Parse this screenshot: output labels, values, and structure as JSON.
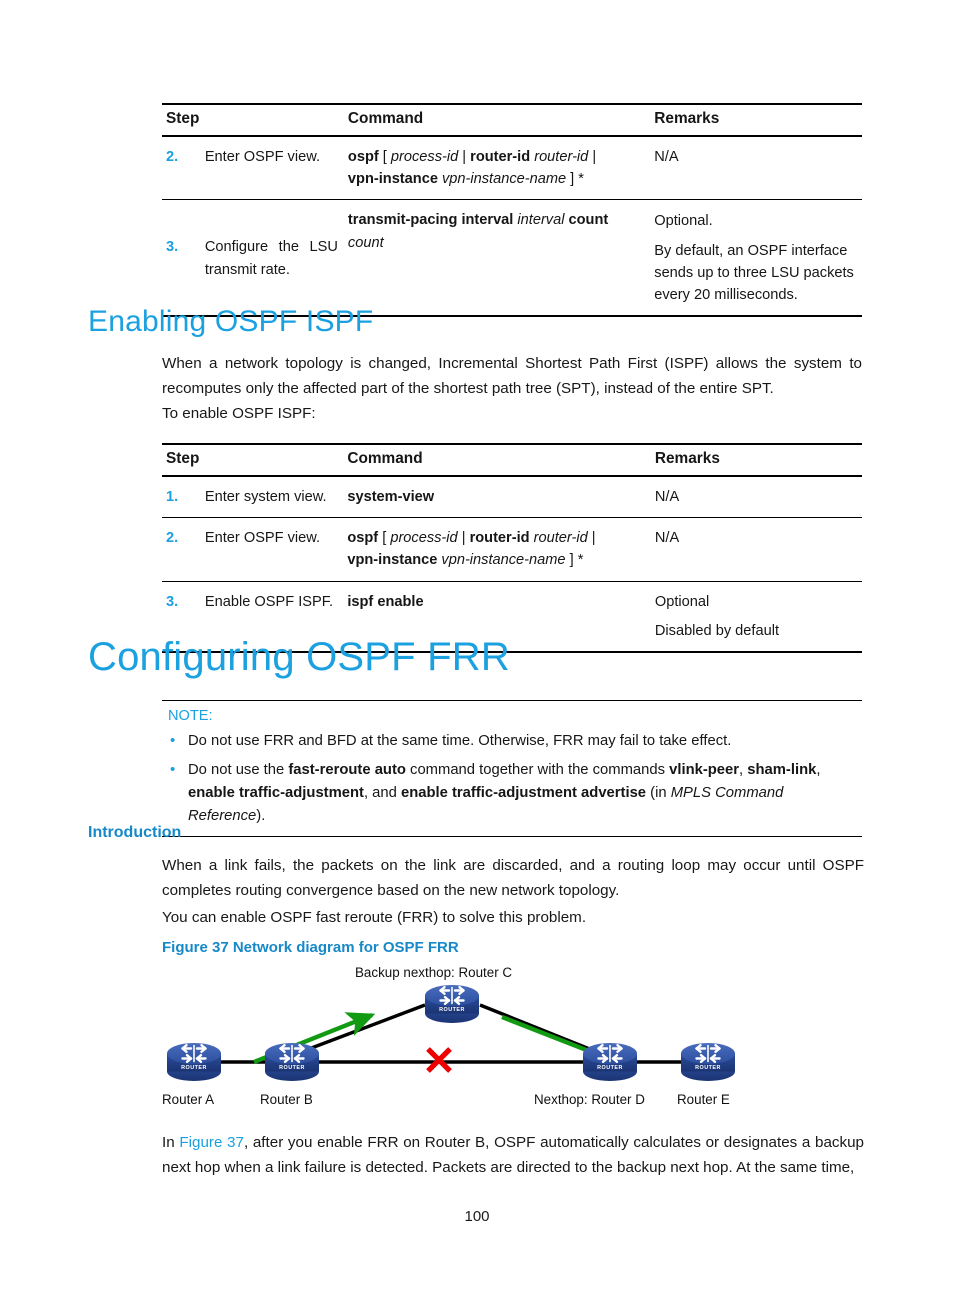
{
  "page": {
    "number": "100"
  },
  "table_top": {
    "headers": [
      "Step",
      "Command",
      "Remarks"
    ],
    "rows": [
      {
        "num": "2.",
        "step": "Enter OSPF view.",
        "command_parts": [
          {
            "text": "ospf",
            "style": "bold"
          },
          {
            "text": " [ ",
            "style": "plain"
          },
          {
            "text": "process-id",
            "style": "italic"
          },
          {
            "text": " | ",
            "style": "plain"
          },
          {
            "text": "router-id",
            "style": "bold"
          },
          {
            "text": " ",
            "style": "plain"
          },
          {
            "text": "router-id",
            "style": "italic"
          },
          {
            "text": " |",
            "style": "plain"
          },
          {
            "text": "\n",
            "style": "break"
          },
          {
            "text": "vpn-instance",
            "style": "bold"
          },
          {
            "text": " ",
            "style": "plain"
          },
          {
            "text": "vpn-instance-name",
            "style": "italic"
          },
          {
            "text": " ] *",
            "style": "plain"
          }
        ],
        "remarks": [
          "N/A"
        ]
      },
      {
        "num": "3.",
        "step": "Configure the LSU transmit rate.",
        "command_parts": [
          {
            "text": "transmit-pacing interval",
            "style": "bold"
          },
          {
            "text": " ",
            "style": "plain"
          },
          {
            "text": "interval",
            "style": "italic"
          },
          {
            "text": " ",
            "style": "plain"
          },
          {
            "text": "count",
            "style": "bold"
          },
          {
            "text": " ",
            "style": "plain"
          },
          {
            "text": "count",
            "style": "italic"
          }
        ],
        "remarks": [
          "Optional.",
          "By default, an OSPF interface sends up to three LSU packets every 20 milliseconds."
        ]
      }
    ]
  },
  "section_ispf": {
    "heading": "Enabling OSPF ISPF",
    "paragraph": "When a network topology is changed, Incremental Shortest Path First (ISPF) allows the system to recomputes only the affected part of the shortest path tree (SPT), instead of the entire SPT.",
    "lead_in": "To enable OSPF ISPF:"
  },
  "table_ispf": {
    "headers": [
      "Step",
      "Command",
      "Remarks"
    ],
    "rows": [
      {
        "num": "1.",
        "step": "Enter system view.",
        "command_parts": [
          {
            "text": "system-view",
            "style": "bold"
          }
        ],
        "remarks": [
          "N/A"
        ]
      },
      {
        "num": "2.",
        "step": "Enter OSPF view.",
        "command_parts": [
          {
            "text": "ospf",
            "style": "bold"
          },
          {
            "text": " [ ",
            "style": "plain"
          },
          {
            "text": "process-id",
            "style": "italic"
          },
          {
            "text": " | ",
            "style": "plain"
          },
          {
            "text": "router-id",
            "style": "bold"
          },
          {
            "text": " ",
            "style": "plain"
          },
          {
            "text": "router-id",
            "style": "italic"
          },
          {
            "text": " |",
            "style": "plain"
          },
          {
            "text": "\n",
            "style": "break"
          },
          {
            "text": "vpn-instance",
            "style": "bold"
          },
          {
            "text": " ",
            "style": "plain"
          },
          {
            "text": "vpn-instance-name",
            "style": "italic"
          },
          {
            "text": " ] *",
            "style": "plain"
          }
        ],
        "remarks": [
          "N/A"
        ]
      },
      {
        "num": "3.",
        "step": "Enable OSPF ISPF.",
        "command_parts": [
          {
            "text": "ispf enable",
            "style": "bold"
          }
        ],
        "remarks": [
          "Optional",
          "Disabled by default"
        ]
      }
    ]
  },
  "section_frr": {
    "heading": "Configuring OSPF FRR",
    "note": {
      "label": "NOTE:",
      "items": [
        [
          {
            "text": "Do not use FRR and BFD at the same time. Otherwise, FRR may fail to take effect.",
            "style": "plain"
          }
        ],
        [
          {
            "text": "Do not use the ",
            "style": "plain"
          },
          {
            "text": "fast-reroute auto",
            "style": "bold"
          },
          {
            "text": " command together with the commands ",
            "style": "plain"
          },
          {
            "text": "vlink-peer",
            "style": "bold"
          },
          {
            "text": ", ",
            "style": "plain"
          },
          {
            "text": "sham-link",
            "style": "bold"
          },
          {
            "text": ", ",
            "style": "plain"
          },
          {
            "text": "enable traffic-adjustment",
            "style": "bold"
          },
          {
            "text": ", and ",
            "style": "plain"
          },
          {
            "text": "enable traffic-adjustment advertise",
            "style": "bold"
          },
          {
            "text": " (in ",
            "style": "plain"
          },
          {
            "text": "MPLS Command Reference",
            "style": "italic"
          },
          {
            "text": ").",
            "style": "plain"
          }
        ]
      ]
    },
    "introduction": {
      "heading": "Introduction",
      "paragraph1": "When a link fails, the packets on the link are discarded, and a routing loop may occur until OSPF completes routing convergence based on the new network topology.",
      "paragraph2": "You can enable OSPF fast reroute (FRR) to solve this problem."
    },
    "figure": {
      "caption": "Figure 37 Network diagram for OSPF FRR",
      "top_label": "Backup nexthop: Router C",
      "nodes": [
        {
          "id": "a",
          "label": "Router A"
        },
        {
          "id": "b",
          "label": "Router B"
        },
        {
          "id": "c",
          "label": ""
        },
        {
          "id": "d",
          "label": "Nexthop: Router D"
        },
        {
          "id": "e",
          "label": "Router E"
        }
      ],
      "icon_text": "ROUTER",
      "link_failure_marker": "x-mark",
      "colors": {
        "router_body": "#2b4d9e",
        "router_top": "#3f63b5",
        "arrow_green": "#129b12",
        "failure_red": "#ee0000",
        "link_black": "#000000"
      }
    },
    "closing_paragraph_parts": [
      {
        "text": "In ",
        "style": "plain"
      },
      {
        "text": "Figure 37",
        "style": "link"
      },
      {
        "text": ", after you enable FRR on Router B, OSPF automatically calculates or designates a backup next hop when a link failure is detected. Packets are directed to the backup next hop. At the same time,",
        "style": "plain"
      }
    ]
  },
  "theme": {
    "accent_blue": "#1ba0e0",
    "heading_blue": "#1789c8"
  }
}
